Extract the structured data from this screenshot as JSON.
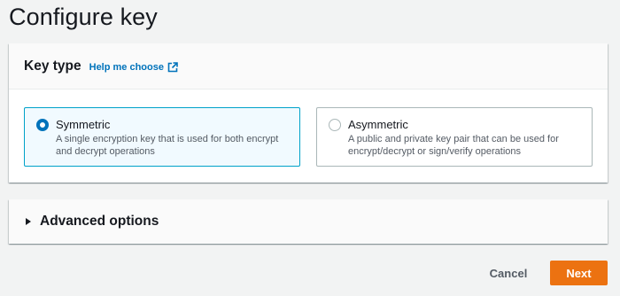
{
  "page": {
    "title": "Configure key"
  },
  "key_type": {
    "heading": "Key type",
    "help_link": "Help me choose",
    "options": [
      {
        "label": "Symmetric",
        "description": "A single encryption key that is used for both encrypt and decrypt operations",
        "selected": true
      },
      {
        "label": "Asymmetric",
        "description": "A public and private key pair that can be used for encrypt/decrypt or sign/verify operations",
        "selected": false
      }
    ]
  },
  "advanced": {
    "heading": "Advanced options",
    "expanded": false
  },
  "footer": {
    "cancel_label": "Cancel",
    "next_label": "Next"
  },
  "colors": {
    "accent": "#0073bb",
    "primary_button": "#ec7211",
    "selected_tile_bg": "#f1faff",
    "selected_tile_border": "#00a1c9"
  },
  "icons": {
    "help_link": "external-link-icon",
    "advanced": "caret-right-icon"
  }
}
